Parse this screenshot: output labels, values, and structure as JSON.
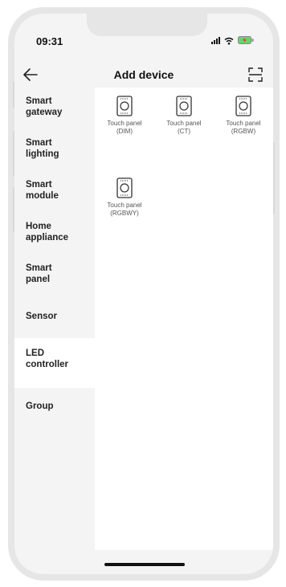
{
  "status_bar": {
    "time": "09:31"
  },
  "header": {
    "title": "Add device"
  },
  "sidebar": {
    "items": [
      {
        "label": "Smart\ngateway"
      },
      {
        "label": "Smart\nlighting"
      },
      {
        "label": "Smart\nmodule"
      },
      {
        "label": "Home\nappliance"
      },
      {
        "label": "Smart\npanel"
      },
      {
        "label": "Sensor"
      },
      {
        "label": "LED\ncontroller"
      },
      {
        "label": "Group"
      }
    ],
    "active_index": 6
  },
  "devices": [
    {
      "name": "Touch panel",
      "type": "(DIM)"
    },
    {
      "name": "Touch panel",
      "type": "(CT)"
    },
    {
      "name": "Touch panel",
      "type": "(RGBW)"
    },
    {
      "name": "Touch panel",
      "type": "(RGBWY)"
    }
  ],
  "icons": {
    "back": "arrow-left-icon",
    "scan": "scan-icon",
    "device": "touch-panel-icon"
  }
}
